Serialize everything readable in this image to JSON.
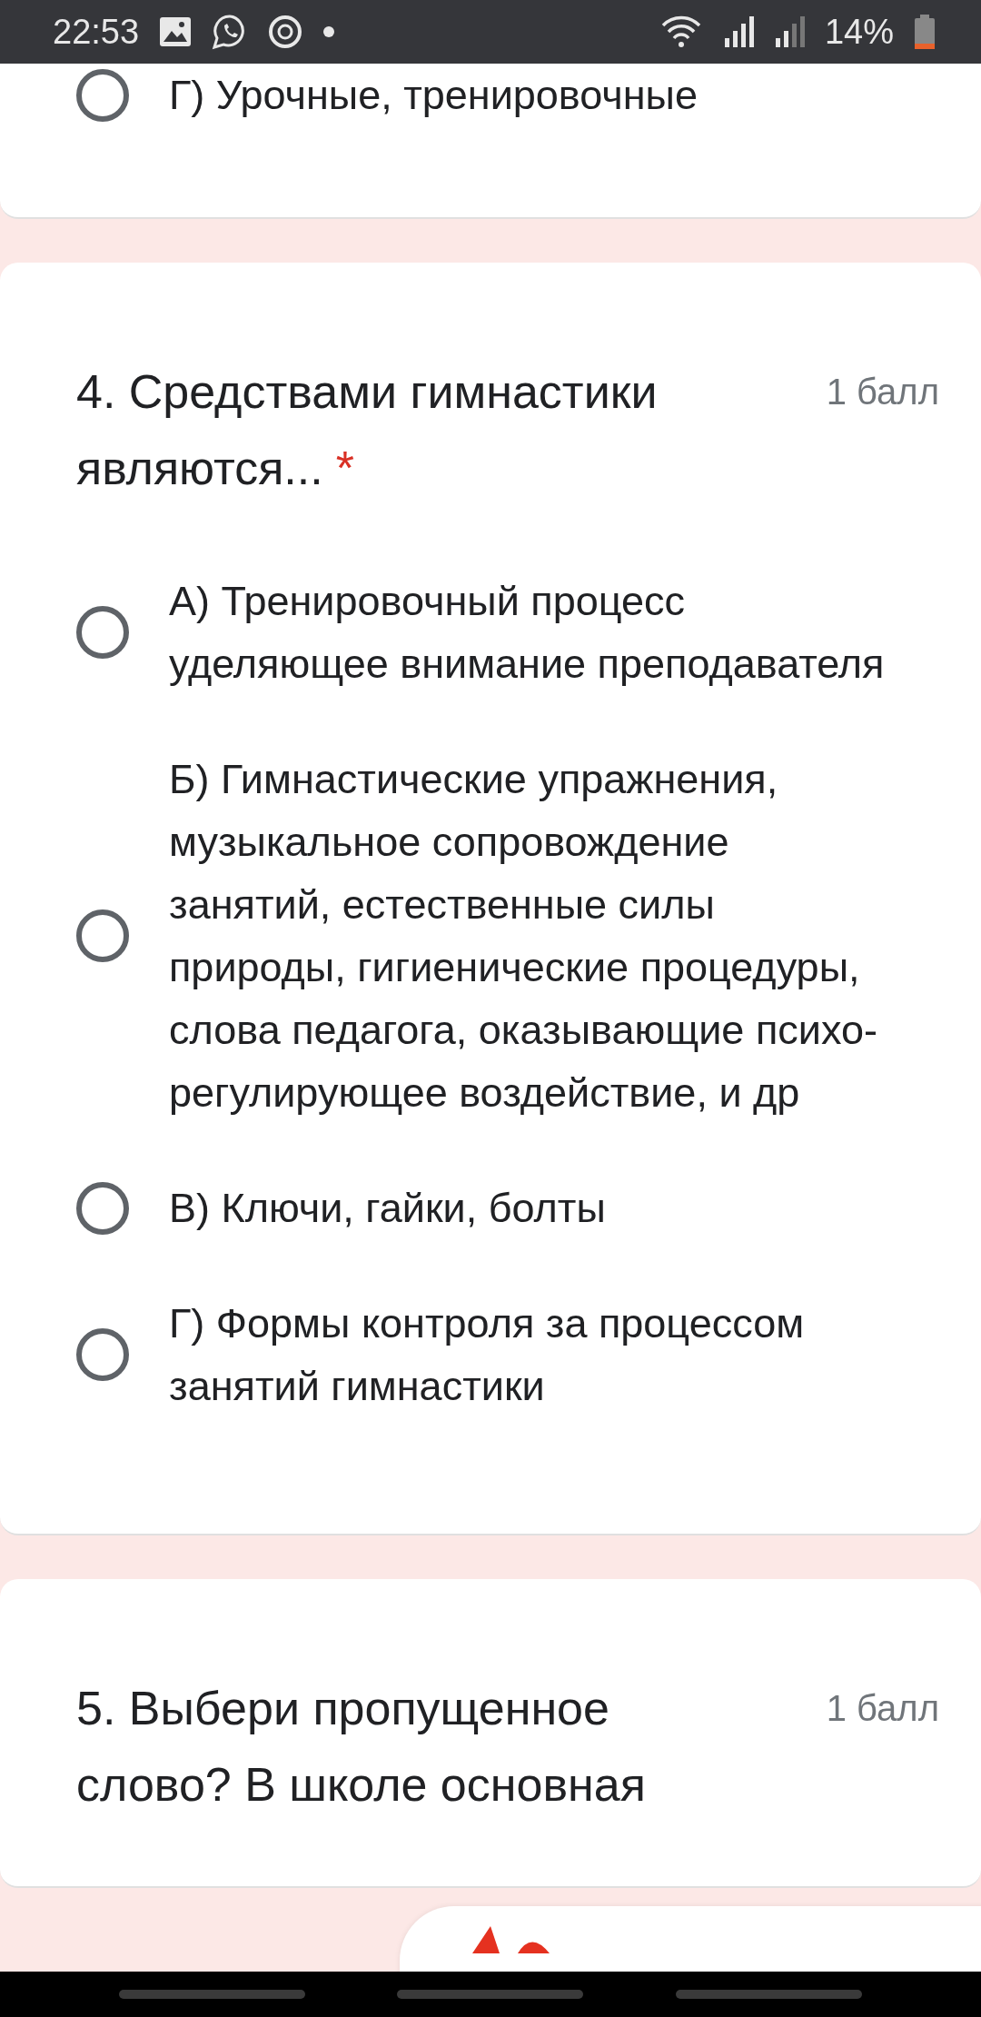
{
  "status_bar": {
    "time": "22:53",
    "battery": "14%"
  },
  "previous_question": {
    "options": [
      {
        "label": "Г) Урочные, тренировочные",
        "selected": false
      }
    ]
  },
  "questions": [
    {
      "title": "4. Средствами гимнастики являются...",
      "required_mark": "*",
      "points": "1 балл",
      "options": [
        {
          "label": "А) Тренировочный процесс уделяющее внимание преподавателя",
          "selected": false
        },
        {
          "label": "Б) Гимнастические упражнения, музыкальное сопровождение занятий, естественные силы природы, гигиенические процедуры, слова педагога, оказывающие психо-регулирующее воздействие, и др",
          "selected": false
        },
        {
          "label": "В) Ключи, гайки, болты",
          "selected": false
        },
        {
          "label": "Г) Формы контроля за процессом занятий гимнастики",
          "selected": false
        }
      ]
    },
    {
      "title": "5. Выбери пропущенное слово? В школе основная",
      "points": "1 балл"
    }
  ]
}
